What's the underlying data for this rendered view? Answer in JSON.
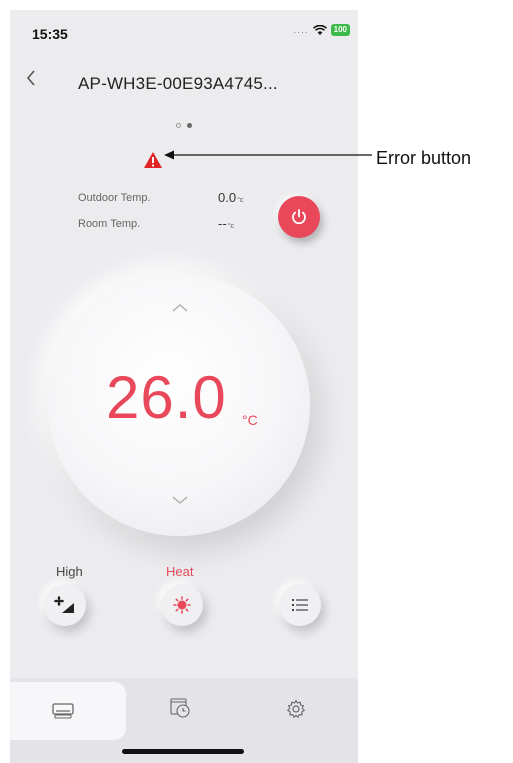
{
  "status_bar": {
    "time": "15:35",
    "signal": "....",
    "battery": "100"
  },
  "header": {
    "title": "AP-WH3E-00E93A4745..."
  },
  "pager": {
    "count": 2,
    "active_index": 1
  },
  "readings": {
    "outdoor_label": "Outdoor Temp.",
    "outdoor_value": "0.0",
    "room_label": "Room Temp.",
    "room_value": "--",
    "unit": "°c"
  },
  "setpoint": {
    "value": "26.0",
    "unit": "°C"
  },
  "controls": {
    "fan_label": "High",
    "mode_label": "Heat"
  },
  "annotation": {
    "label": "Error button"
  },
  "colors": {
    "accent": "#e8485a",
    "error": "#e02424",
    "background": "#ececef"
  },
  "icons": {
    "back": "chevron-left-icon",
    "error": "warning-triangle-icon",
    "power": "power-icon",
    "up": "chevron-up-icon",
    "down": "chevron-down-icon",
    "fan": "fan-speed-icon",
    "mode": "sun-heat-icon",
    "menu": "list-menu-icon",
    "tab_home": "device-unit-icon",
    "tab_schedule": "schedule-clock-icon",
    "tab_settings": "gear-icon"
  }
}
